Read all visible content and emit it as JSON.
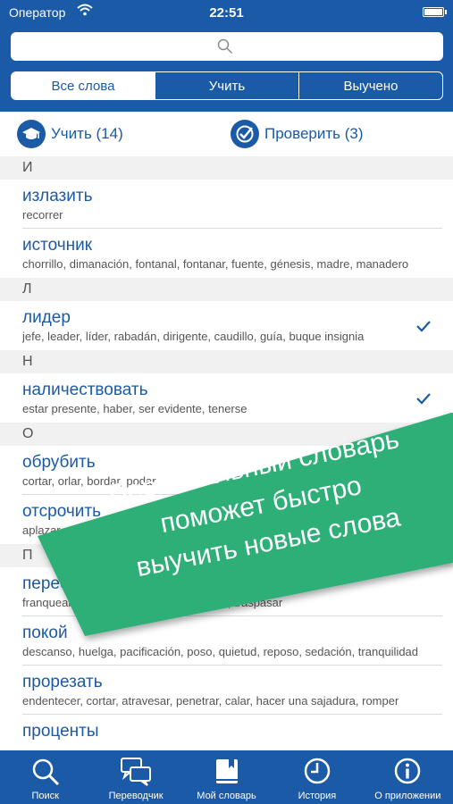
{
  "status_bar": {
    "carrier": "Оператор",
    "time": "22:51"
  },
  "search": {
    "placeholder": ""
  },
  "segments": [
    "Все слова",
    "Учить",
    "Выучено"
  ],
  "actions": {
    "learn_label": "Учить (14)",
    "check_label": "Проверить (3)"
  },
  "list": {
    "sections": [
      {
        "letter": "И",
        "items": [
          {
            "word": "излазить",
            "translation": "recorrer",
            "checked": false
          },
          {
            "word": "источник",
            "translation": "chorrillo, dimanación, fontanal, fontanar, fuente, génesis, madre, manadero",
            "checked": false
          }
        ]
      },
      {
        "letter": "Л",
        "items": [
          {
            "word": "лидер",
            "translation": "jefe, leader, líder, rabadán, dirigente, caudillo, guía, buque insignia",
            "checked": true
          }
        ]
      },
      {
        "letter": "Н",
        "items": [
          {
            "word": "наличествовать",
            "translation": "estar presente, haber, ser evidente, tenerse",
            "checked": true
          }
        ]
      },
      {
        "letter": "О",
        "items": [
          {
            "word": "обрубить",
            "translation": "cortar, orlar, bordar, podar",
            "checked": false
          },
          {
            "word": "отсрочить",
            "translation": "aplazar",
            "checked": false
          }
        ]
      },
      {
        "letter": "П",
        "items": [
          {
            "word": "переступить",
            "translation": "franquear, traspasar, atravesar, pasarse, traspasar",
            "checked": false
          },
          {
            "word": "покой",
            "translation": "descanso, huelga, pacificación, poso, quietud, reposo, sedación, tranquilidad",
            "checked": false
          },
          {
            "word": "прорезать",
            "translation": "endentecer, cortar, atravesar, penetrar, calar, hacer una sajadura, romper",
            "checked": false
          },
          {
            "word": "проценты",
            "translation": "",
            "checked": false
          }
        ]
      }
    ]
  },
  "banner": {
    "lines": [
      "Персональный словарь",
      "поможет быстро",
      "выучить новые слова"
    ],
    "color": "#2eaf78"
  },
  "tabs": [
    "Поиск",
    "Переводчик",
    "Мой словарь",
    "История",
    "О приложении"
  ],
  "colors": {
    "primary": "#1a5aa6",
    "banner": "#2eaf78"
  }
}
